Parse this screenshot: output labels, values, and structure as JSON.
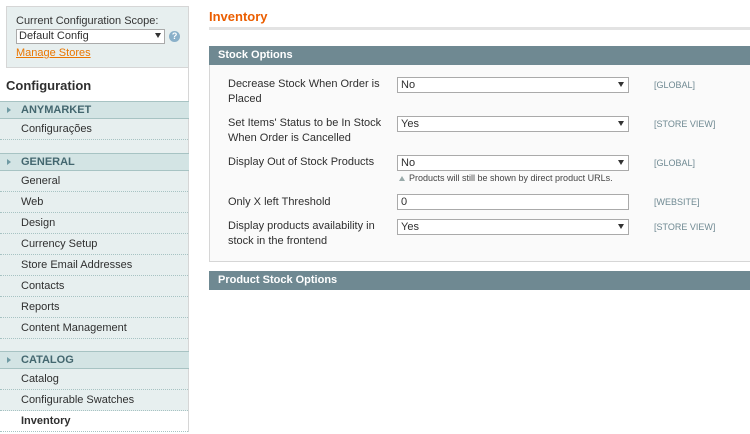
{
  "scope": {
    "label": "Current Configuration Scope:",
    "selected": "Default Config",
    "manage_link": "Manage Stores"
  },
  "sidebar": {
    "title": "Configuration",
    "groups": [
      {
        "heading": "ANYMARKET",
        "items": [
          {
            "label": "Configurações"
          }
        ]
      },
      {
        "heading": "GENERAL",
        "items": [
          {
            "label": "General"
          },
          {
            "label": "Web"
          },
          {
            "label": "Design"
          },
          {
            "label": "Currency Setup"
          },
          {
            "label": "Store Email Addresses"
          },
          {
            "label": "Contacts"
          },
          {
            "label": "Reports"
          },
          {
            "label": "Content Management"
          }
        ]
      },
      {
        "heading": "CATALOG",
        "items": [
          {
            "label": "Catalog"
          },
          {
            "label": "Configurable Swatches"
          },
          {
            "label": "Inventory",
            "active": true
          }
        ]
      }
    ]
  },
  "main": {
    "title": "Inventory",
    "sections": [
      {
        "title": "Stock Options"
      },
      {
        "title": "Product Stock Options"
      }
    ],
    "fields": [
      {
        "label": "Decrease Stock When Order is Placed",
        "value": "No",
        "scope": "[GLOBAL]"
      },
      {
        "label": "Set Items' Status to be In Stock When Order is Cancelled",
        "value": "Yes",
        "scope": "[STORE VIEW]"
      },
      {
        "label": "Display Out of Stock Products",
        "value": "No",
        "scope": "[GLOBAL]",
        "note": "Products will still be shown by direct product URLs."
      },
      {
        "label": "Only X left Threshold",
        "value": "0",
        "scope": "[WEBSITE]"
      },
      {
        "label": "Display products availability in stock in the frontend",
        "value": "Yes",
        "scope": "[STORE VIEW]"
      }
    ]
  }
}
